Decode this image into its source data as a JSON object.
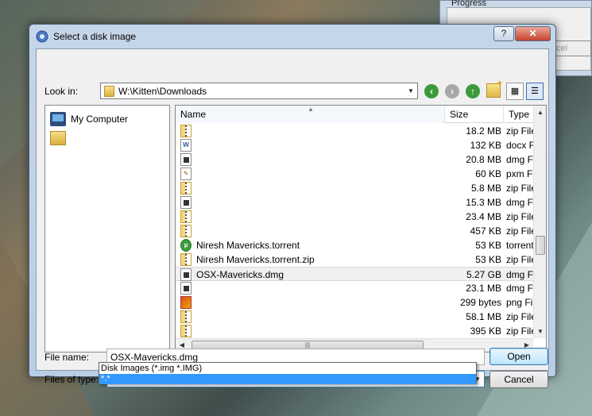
{
  "background_window": {
    "title": "Progress",
    "cancel_label": "ncel"
  },
  "dialog": {
    "title": "Select a disk image",
    "help_label": "?",
    "close_label": "✕",
    "look_in_label": "Look in:",
    "look_in_value": "W:\\Kitten\\Downloads",
    "places": [
      {
        "label": "My Computer",
        "icon": "computer-icon"
      },
      {
        "label": "",
        "icon": "user-folder-icon"
      }
    ],
    "columns": {
      "name": "Name",
      "size": "Size",
      "type": "Type"
    },
    "files": [
      {
        "name": "",
        "size": "18.2 MB",
        "type": "zip File",
        "icon": "zip"
      },
      {
        "name": "",
        "size": "132 KB",
        "type": "docx File",
        "icon": "docx"
      },
      {
        "name": "",
        "size": "20.8 MB",
        "type": "dmg File",
        "icon": "dmg"
      },
      {
        "name": "",
        "size": "60 KB",
        "type": "pxm File",
        "icon": "pxm"
      },
      {
        "name": "",
        "size": "5.8 MB",
        "type": "zip File",
        "icon": "zip"
      },
      {
        "name": "",
        "size": "15.3 MB",
        "type": "dmg File",
        "icon": "dmg"
      },
      {
        "name": "",
        "size": "23.4 MB",
        "type": "zip File",
        "icon": "zip"
      },
      {
        "name": "",
        "size": "457 KB",
        "type": "zip File",
        "icon": "zip"
      },
      {
        "name": "Niresh Mavericks.torrent",
        "size": "53 KB",
        "type": "torrent",
        "icon": "torrent"
      },
      {
        "name": "Niresh Mavericks.torrent.zip",
        "size": "53 KB",
        "type": "zip File",
        "icon": "zip"
      },
      {
        "name": "OSX-Mavericks.dmg",
        "size": "5.27 GB",
        "type": "dmg File",
        "icon": "dmg",
        "selected": true
      },
      {
        "name": "",
        "size": "23.1 MB",
        "type": "dmg File",
        "icon": "dmg"
      },
      {
        "name": "",
        "size": "299 bytes",
        "type": "png File",
        "icon": "png"
      },
      {
        "name": "",
        "size": "58.1 MB",
        "type": "zip File",
        "icon": "zip"
      },
      {
        "name": "",
        "size": "395 KB",
        "type": "zip File",
        "icon": "zip"
      }
    ],
    "file_name_label": "File name:",
    "file_name_value": "OSX-Mavericks.dmg",
    "files_of_type_label": "Files of type:",
    "files_of_type_value": "*.*",
    "type_options": [
      "Disk Images (*.img *.IMG)",
      "*.*"
    ],
    "open_label": "Open",
    "cancel_label": "Cancel"
  }
}
